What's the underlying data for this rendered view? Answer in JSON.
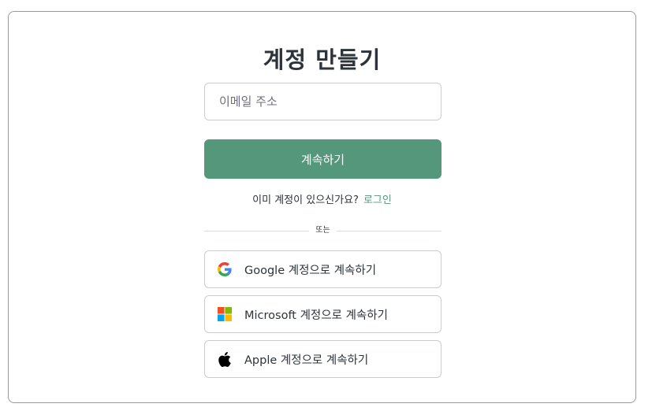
{
  "page": {
    "title": "계정 만들기"
  },
  "form": {
    "email_placeholder": "이메일 주소",
    "continue_label": "계속하기",
    "have_account_text": "이미 계정이 있으신가요?",
    "login_link": "로그인",
    "divider_text": "또는"
  },
  "social": [
    {
      "label": "Google 계정으로 계속하기",
      "icon": "google-icon"
    },
    {
      "label": "Microsoft 계정으로 계속하기",
      "icon": "microsoft-icon"
    },
    {
      "label": "Apple 계정으로 계속하기",
      "icon": "apple-icon"
    }
  ],
  "colors": {
    "accent": "#55977b",
    "text": "#2d333a",
    "border": "#c9cdd3"
  }
}
